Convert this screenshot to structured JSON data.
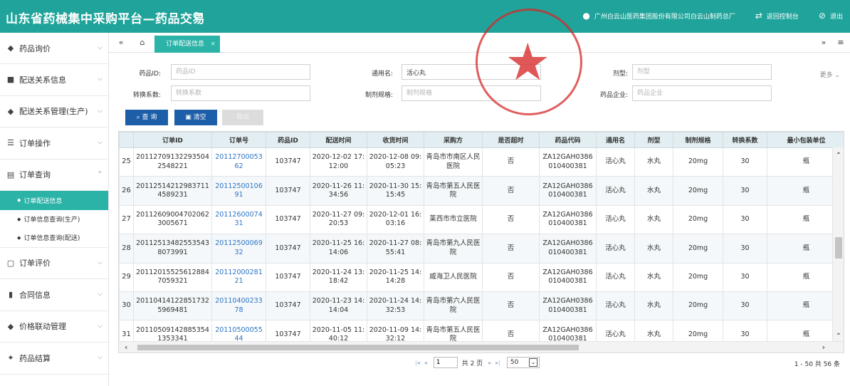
{
  "header": {
    "title": "山东省药械集中采购平台—药品交易",
    "company": "广州白云山医药集团股份有限公司白云山制药总厂",
    "back_label": "返回控制台",
    "logout_label": "退出"
  },
  "sidebar": {
    "items": [
      {
        "label": "药品询价",
        "icon": "diamond-icon"
      },
      {
        "label": "配送关系信息",
        "icon": "truck-icon"
      },
      {
        "label": "配送关系管理(生产)",
        "icon": "diamond-icon"
      },
      {
        "label": "订单操作",
        "icon": "list-icon"
      },
      {
        "label": "订单查询",
        "icon": "document-search-icon"
      },
      {
        "label": "订单评价",
        "icon": "bag-icon"
      },
      {
        "label": "合同信息",
        "icon": "contract-icon"
      },
      {
        "label": "价格联动管理",
        "icon": "diamond-icon"
      },
      {
        "label": "药品结算",
        "icon": "handshake-icon"
      }
    ],
    "sub_items": [
      {
        "label": "订单配送信息",
        "active": true
      },
      {
        "label": "订单信息查询(生产)",
        "active": false
      },
      {
        "label": "订单信息查询(配送)",
        "active": false
      }
    ]
  },
  "tabs": {
    "active_tab": "订单配送信息"
  },
  "form": {
    "drug_id_label": "药品ID:",
    "drug_id_placeholder": "药品ID",
    "common_name_label": "通用名:",
    "common_name_value": "活心丸",
    "dosage_form_label": "剂型:",
    "dosage_form_placeholder": "剂型",
    "conversion_label": "转换系数:",
    "conversion_placeholder": "转换系数",
    "spec_label": "制剂规格:",
    "spec_placeholder": "制剂规格",
    "enterprise_label": "药品企业:",
    "enterprise_placeholder": "药品企业",
    "more_label": "更多"
  },
  "buttons": {
    "query": "查 询",
    "clear": "清空",
    "export": "导出"
  },
  "table": {
    "columns": [
      "订单ID",
      "订单号",
      "药品ID",
      "配送时间",
      "收货时间",
      "采购方",
      "是否超时",
      "药品代码",
      "通用名",
      "剂型",
      "制剂规格",
      "转换系数",
      "最小包装单位"
    ],
    "rows": [
      {
        "n": "25",
        "order_id": "201127091322935042548221",
        "order_no": "2011270005362",
        "drug_id": "103747",
        "ship": "2020-12-02 17:12:00",
        "recv": "2020-12-08 09:05:23",
        "buyer": "青岛市市南区人民医院",
        "overdue": "否",
        "code": "ZA12GAH0386010400381",
        "name": "活心丸",
        "form": "水丸",
        "spec": "20mg",
        "factor": "30",
        "unit": "瓶"
      },
      {
        "n": "26",
        "order_id": "201125142129837114589231",
        "order_no": "2011250010691",
        "drug_id": "103747",
        "ship": "2020-11-26 11:34:56",
        "recv": "2020-11-30 15:15:45",
        "buyer": "青岛市第五人民医院",
        "overdue": "否",
        "code": "ZA12GAH0386010400381",
        "name": "活心丸",
        "form": "水丸",
        "spec": "20mg",
        "factor": "30",
        "unit": "瓶"
      },
      {
        "n": "27",
        "order_id": "201126090047020623005671",
        "order_no": "2011260007431",
        "drug_id": "103747",
        "ship": "2020-11-27 09:20:53",
        "recv": "2020-12-01 16:03:16",
        "buyer": "莱西市市立医院",
        "overdue": "否",
        "code": "ZA12GAH0386010400381",
        "name": "活心丸",
        "form": "水丸",
        "spec": "20mg",
        "factor": "30",
        "unit": "瓶"
      },
      {
        "n": "28",
        "order_id": "201125134825535438073991",
        "order_no": "2011250006932",
        "drug_id": "103747",
        "ship": "2020-11-25 16:14:06",
        "recv": "2020-11-27 08:55:41",
        "buyer": "青岛市第九人民医院",
        "overdue": "否",
        "code": "ZA12GAH0386010400381",
        "name": "活心丸",
        "form": "水丸",
        "spec": "20mg",
        "factor": "30",
        "unit": "瓶"
      },
      {
        "n": "29",
        "order_id": "201120155256128847059321",
        "order_no": "2011200028121",
        "drug_id": "103747",
        "ship": "2020-11-24 13:18:42",
        "recv": "2020-11-25 14:14:28",
        "buyer": "威海卫人民医院",
        "overdue": "否",
        "code": "ZA12GAH0386010400381",
        "name": "活心丸",
        "form": "水丸",
        "spec": "20mg",
        "factor": "30",
        "unit": "瓶"
      },
      {
        "n": "30",
        "order_id": "201104141228517325969481",
        "order_no": "2011040023378",
        "drug_id": "103747",
        "ship": "2020-11-23 14:14:04",
        "recv": "2020-11-24 14:32:53",
        "buyer": "青岛市第六人民医院",
        "overdue": "否",
        "code": "ZA12GAH0386010400381",
        "name": "活心丸",
        "form": "水丸",
        "spec": "20mg",
        "factor": "30",
        "unit": "瓶"
      },
      {
        "n": "31",
        "order_id": "201105091428853541353341",
        "order_no": "2011050005544",
        "drug_id": "103747",
        "ship": "2020-11-05 11:40:12",
        "recv": "2020-11-09 14:32:12",
        "buyer": "青岛市第五人民医院",
        "overdue": "否",
        "code": "ZA12GAH0386010400381",
        "name": "活心丸",
        "form": "水丸",
        "spec": "20mg",
        "factor": "30",
        "unit": "瓶"
      }
    ]
  },
  "pager": {
    "current_page": "1",
    "total_pages_text": "共 2 页",
    "page_size": "50",
    "info": "1 - 50  共 56 条"
  },
  "colors": {
    "brand": "#1fa39a",
    "primary_button": "#1d5ea8",
    "stamp": "#d62828"
  }
}
